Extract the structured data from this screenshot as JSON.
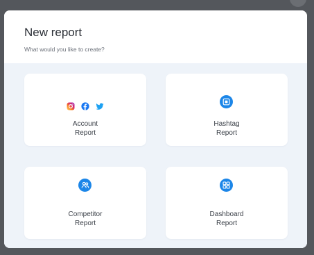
{
  "modal": {
    "title": "New report",
    "subtitle": "What would you like to create?"
  },
  "cards": [
    {
      "line1": "Account",
      "line2": "Report",
      "icons": [
        "instagram-icon",
        "facebook-icon",
        "twitter-icon"
      ]
    },
    {
      "line1": "Hashtag",
      "line2": "Report",
      "icons": [
        "hashtag-report-icon"
      ]
    },
    {
      "line1": "Competitor",
      "line2": "Report",
      "icons": [
        "competitor-users-icon"
      ]
    },
    {
      "line1": "Dashboard",
      "line2": "Report",
      "icons": [
        "dashboard-grid-icon"
      ]
    }
  ],
  "colors": {
    "accent": "#1c86e8",
    "instagram": "#d62976",
    "facebook": "#1877f2",
    "twitter": "#1da1f2",
    "panel_background": "#eef3f9"
  }
}
